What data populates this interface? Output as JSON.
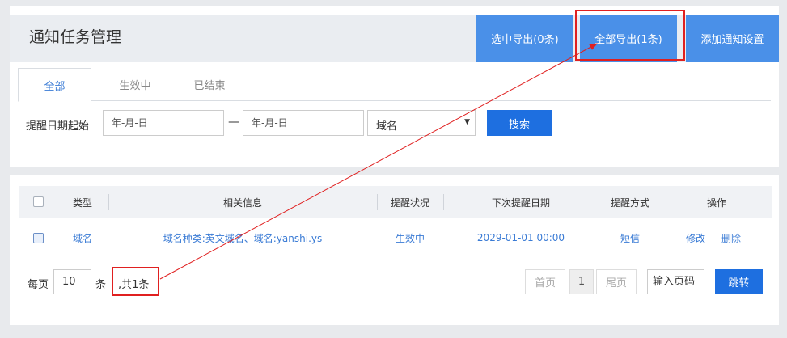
{
  "page": {
    "title": "通知任务管理"
  },
  "header_buttons": {
    "export_selected": "选中导出(0条)",
    "export_all": "全部导出(1条)",
    "add_setting": "添加通知设置"
  },
  "tabs": [
    {
      "label": "全部",
      "active": true
    },
    {
      "label": "生效中",
      "active": false
    },
    {
      "label": "已结束",
      "active": false
    }
  ],
  "filter": {
    "label": "提醒日期起始",
    "start_placeholder": "年-月-日",
    "separator": "—",
    "end_placeholder": "年-月-日",
    "type_selected": "域名",
    "search_label": "搜索"
  },
  "table": {
    "columns": [
      "类型",
      "相关信息",
      "提醒状况",
      "下次提醒日期",
      "提醒方式",
      "操作"
    ],
    "rows": [
      {
        "type": "域名",
        "info": "域名种类:英文域名、域名:yanshi.ys",
        "status": "生效中",
        "next_date": "2029-01-01 00:00",
        "method": "短信",
        "edit": "修改",
        "delete": "删除"
      }
    ]
  },
  "pager": {
    "per_page_label": "每页",
    "per_page_value": "10",
    "per_page_unit": "条",
    "total_text": ",共1条",
    "first": "首页",
    "current": "1",
    "last": "尾页",
    "goto_placeholder": "输入页码",
    "jump": "跳转"
  },
  "colors": {
    "primary": "#1e6fe0",
    "header_button": "#4a90e8",
    "link": "#3a7bd5",
    "annotation": "#e02020"
  }
}
